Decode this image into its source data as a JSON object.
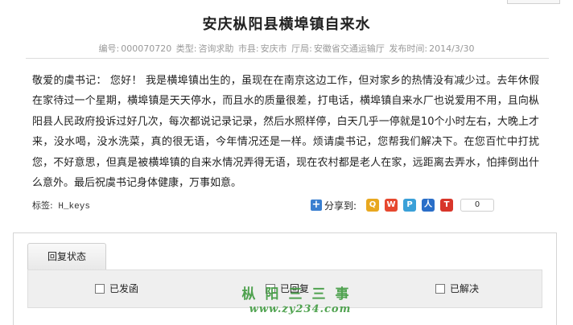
{
  "page": {
    "title": "安庆枞阳县横埠镇自来水"
  },
  "meta": {
    "id_label": "编号:",
    "id_value": "000070720",
    "type_label": "类型:",
    "type_value": "咨询求助",
    "city_label": "市县:",
    "city_value": "安庆市",
    "dept_label": "厅局:",
    "dept_value": "安徽省交通运输厅",
    "date_label": "发布时间:",
    "date_value": "2014/3/30"
  },
  "article": {
    "body": "敬爱的虞书记：  您好！  我是横埠镇出生的，虽现在在南京这边工作，但对家乡的热情没有减少过。去年休假在家待过一个星期，横埠镇是天天停水，而且水的质量很差，打电话，横埠镇自来水厂也说爱用不用，且向枞阳县人民政府投诉过好几次，每次都说记录记录，然后水照样停，白天几乎一停就是10个小时左右，大晚上才来，没水喝，没水洗菜，真的很无语，今年情况还是一样。烦请虞书记，您帮我们解决下。在您百忙中打扰您，不好意思，但真是被横埠镇的自来水情况弄得无语，现在农村都是老人在家，远距离去弄水，怕摔倒出什么意外。最后祝虞书记身体健康，万事如意。"
  },
  "tags": {
    "label": "标签:",
    "value": "H_keys"
  },
  "share": {
    "label": "分享到:",
    "count": "0",
    "icons": [
      "qzone-icon",
      "weibo-icon",
      "pengyou-icon",
      "renren-icon",
      "tencent-weibo-icon"
    ],
    "icon_colors": [
      "#e8a820",
      "#e6482f",
      "#3aa0d8",
      "#2a6ec8",
      "#d8362a"
    ]
  },
  "reply": {
    "tab_label": "回复状态",
    "options": [
      {
        "label": "已发函",
        "checked": false
      },
      {
        "label": "已回复",
        "checked": false
      },
      {
        "label": "已解决",
        "checked": false
      }
    ]
  },
  "watermark": {
    "line1": "枞阳三三事",
    "line2": "www.zy234.com"
  }
}
